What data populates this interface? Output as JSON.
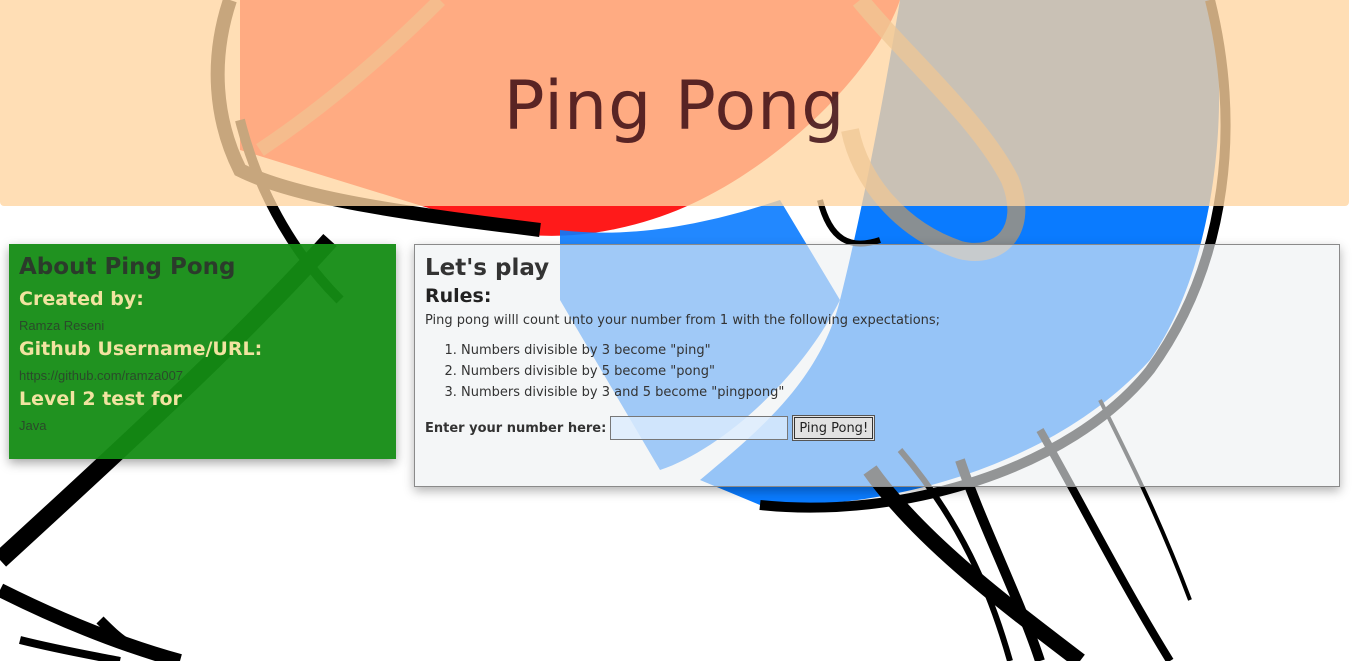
{
  "header": {
    "title": "Ping Pong"
  },
  "about": {
    "heading": "About Ping Pong",
    "created_by_label": "Created by:",
    "created_by_value": "Ramza Reseni",
    "github_label": "Github Username/URL:",
    "github_value": "https://github.com/ramza007",
    "level_label": "Level 2 test for",
    "level_value": "Java"
  },
  "play": {
    "heading": "Let's play",
    "rules_heading": "Rules:",
    "intro": "Ping pong willl count unto your number from 1 with the following expectations;",
    "rules": [
      "Numbers divisible by 3 become \"ping\"",
      "Numbers divisible by 5 become \"pong\"",
      "Numbers divisible by 3 and 5 become \"pingpong\""
    ],
    "input_label": "Enter your number here:",
    "input_value": "",
    "button_label": "Ping Pong!"
  },
  "colors": {
    "header_bg": "#ffd5a0",
    "about_bg": "#148c14",
    "about_subheading": "#f1e3a0"
  }
}
